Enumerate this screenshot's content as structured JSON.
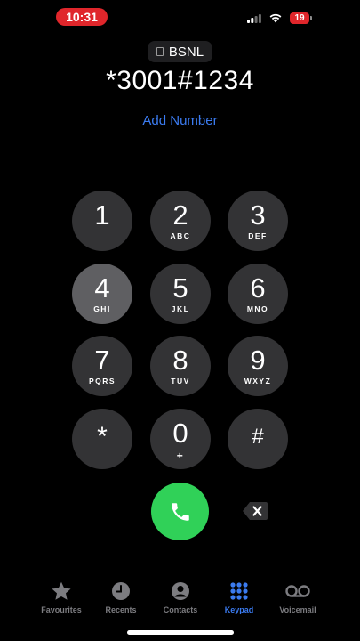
{
  "status_bar": {
    "time": "10:31",
    "battery_level": "19",
    "signal_icon": "cellular-signal-icon",
    "wifi_icon": "wifi-icon"
  },
  "carrier": {
    "label": "BSNL",
    "icon": "sim-card-icon"
  },
  "dialer": {
    "number": "*3001#1234",
    "add_number_label": "Add Number"
  },
  "keypad": {
    "keys": [
      {
        "digit": "1",
        "letters": ""
      },
      {
        "digit": "2",
        "letters": "ABC"
      },
      {
        "digit": "3",
        "letters": "DEF"
      },
      {
        "digit": "4",
        "letters": "GHI"
      },
      {
        "digit": "5",
        "letters": "JKL"
      },
      {
        "digit": "6",
        "letters": "MNO"
      },
      {
        "digit": "7",
        "letters": "PQRS"
      },
      {
        "digit": "8",
        "letters": "TUV"
      },
      {
        "digit": "9",
        "letters": "WXYZ"
      },
      {
        "digit": "*",
        "letters": ""
      },
      {
        "digit": "0",
        "letters": "+"
      },
      {
        "digit": "#",
        "letters": ""
      }
    ],
    "pressed_key": "4"
  },
  "actions": {
    "call_icon": "phone-icon",
    "delete_icon": "backspace-icon"
  },
  "tabs": [
    {
      "label": "Favourites",
      "icon": "star-icon"
    },
    {
      "label": "Recents",
      "icon": "clock-icon"
    },
    {
      "label": "Contacts",
      "icon": "person-circle-icon"
    },
    {
      "label": "Keypad",
      "icon": "keypad-grid-icon",
      "active": true
    },
    {
      "label": "Voicemail",
      "icon": "voicemail-icon"
    }
  ],
  "colors": {
    "accent": "#3b7bf0",
    "call_green": "#30d158",
    "status_red": "#e0262b",
    "key_background": "#333335"
  }
}
